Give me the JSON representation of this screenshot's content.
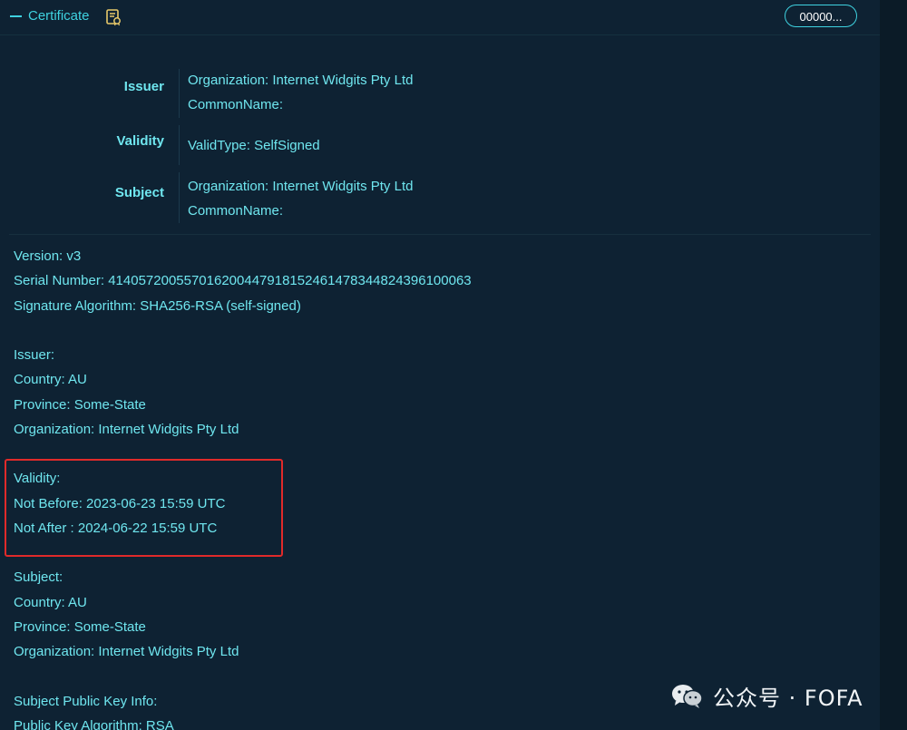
{
  "header": {
    "title": "Certificate",
    "icon": "certificate-icon",
    "pill_label": "00000..."
  },
  "summary": {
    "issuer": {
      "label": "Issuer",
      "organization": "Organization: Internet Widgits Pty Ltd",
      "common_name": "CommonName:"
    },
    "validity": {
      "label": "Validity",
      "valid_type": "ValidType: SelfSigned"
    },
    "subject": {
      "label": "Subject",
      "organization": "Organization: Internet Widgits Pty Ltd",
      "common_name": "CommonName:"
    }
  },
  "details": {
    "lines": [
      "Version: v3",
      "Serial Number: 414057200557016200447918152461478344824396100063",
      "Signature Algorithm: SHA256-RSA (self-signed)",
      "",
      "Issuer:",
      "Country: AU",
      "Province: Some-State",
      "Organization: Internet Widgits Pty Ltd",
      "",
      "Validity:",
      "Not Before: 2023-06-23 15:59 UTC",
      "Not After : 2024-06-22 15:59 UTC",
      "",
      "Subject:",
      "Country: AU",
      "Province: Some-State",
      "Organization: Internet Widgits Pty Ltd",
      "",
      "Subject Public Key Info:",
      "Public Key Algorithm: RSA"
    ]
  },
  "watermark": {
    "text": "公众号 · FOFA",
    "icon": "wechat-icon"
  },
  "colors": {
    "accent": "#3fd2e0",
    "text": "#6fe6ef",
    "background": "#0e2233",
    "highlight": "#e02a2a"
  }
}
